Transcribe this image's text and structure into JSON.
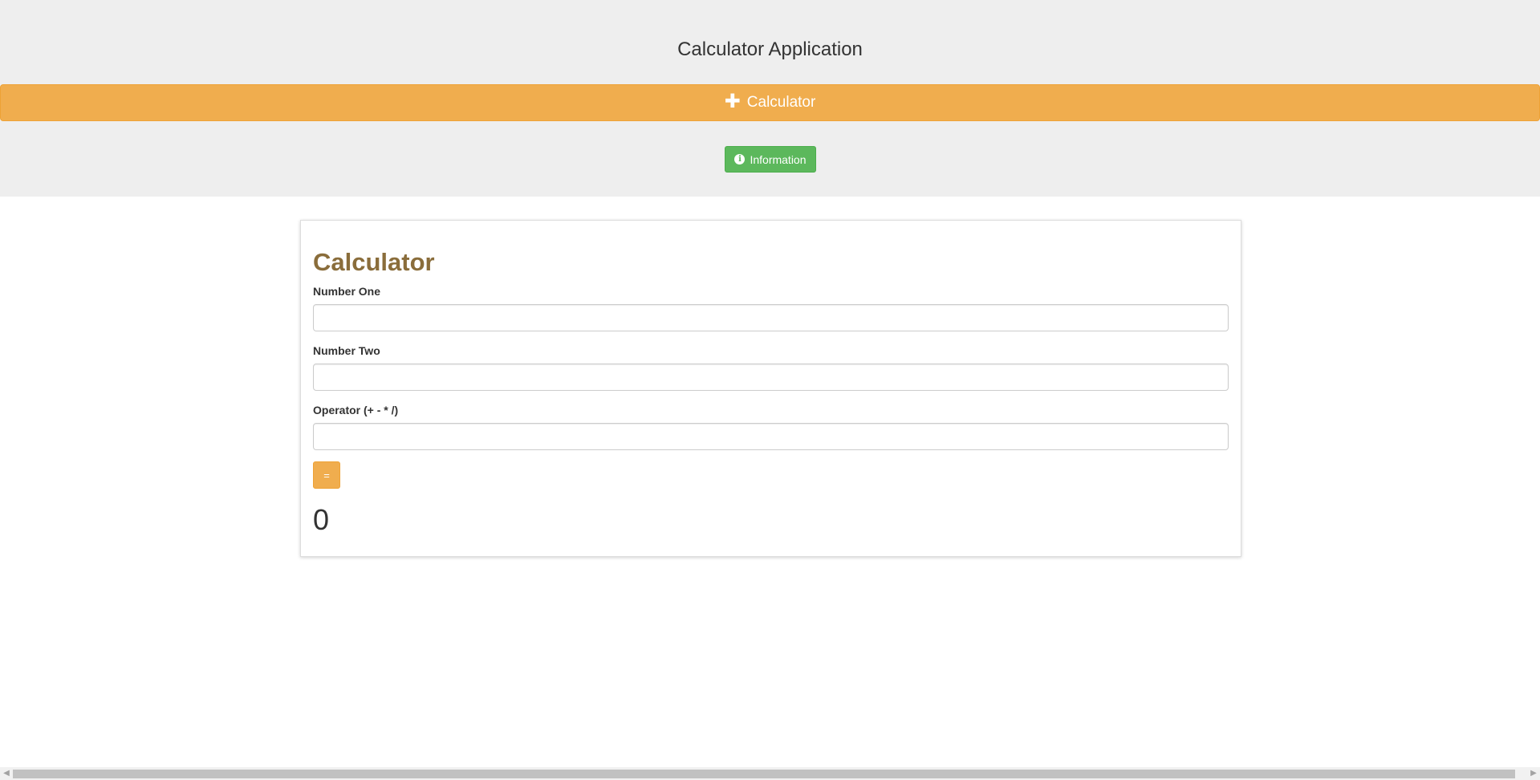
{
  "header": {
    "app_title": "Calculator Application",
    "calculator_bar_label": "Calculator",
    "info_button_label": "Information"
  },
  "card": {
    "title": "Calculator",
    "fields": [
      {
        "label": "Number One",
        "value": ""
      },
      {
        "label": "Number Two",
        "value": ""
      },
      {
        "label": "Operator (+ - * /)",
        "value": ""
      }
    ],
    "equals_label": "=",
    "result": "0"
  },
  "icons": {
    "calculator_bar": "plus-icon",
    "info_button": "info-circle-icon"
  },
  "colors": {
    "header_bg": "#eeeeee",
    "warning": "#f0ad4e",
    "success": "#5cb85c",
    "title": "#8a6d3b"
  }
}
